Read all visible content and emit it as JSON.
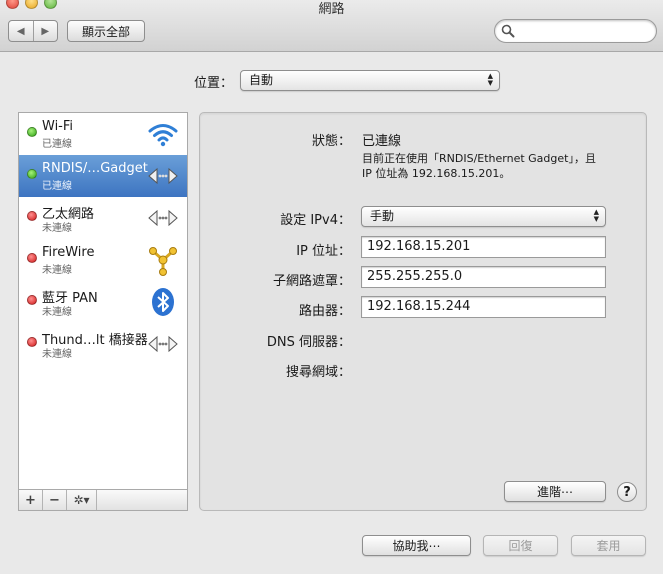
{
  "window": {
    "title": "網路"
  },
  "toolbar": {
    "back_label": "◀",
    "forward_label": "▶",
    "show_all_label": "顯示全部",
    "search_placeholder": "",
    "search_value": ""
  },
  "location": {
    "label": "位置：",
    "value": "自動"
  },
  "services": [
    {
      "name": "Wi-Fi",
      "status": "已連線",
      "status_color": "green",
      "icon": "wifi-icon",
      "selected": false
    },
    {
      "name": "RNDIS/…Gadget",
      "status": "已連線",
      "status_color": "green",
      "icon": "ethernet-arrows-icon",
      "selected": true
    },
    {
      "name": "乙太網路",
      "status": "未連線",
      "status_color": "red",
      "icon": "ethernet-arrows-icon",
      "selected": false
    },
    {
      "name": "FireWire",
      "status": "未連線",
      "status_color": "red",
      "icon": "firewire-icon",
      "selected": false
    },
    {
      "name": "藍牙 PAN",
      "status": "未連線",
      "status_color": "red",
      "icon": "bluetooth-icon",
      "selected": false
    },
    {
      "name": "Thund…lt 橋接器",
      "status": "未連線",
      "status_color": "red",
      "icon": "ethernet-arrows-icon",
      "selected": false
    }
  ],
  "sidebar_actions": {
    "add": "+",
    "remove": "−",
    "gear": "✲▾"
  },
  "detail": {
    "status_label": "狀態：",
    "status_value": "已連線",
    "status_desc_line1": "目前正在使用「RNDIS/Ethernet Gadget」，且",
    "status_desc_line2": "IP 位址為 192.168.15.201。",
    "configure_label": "設定 IPv4：",
    "configure_value": "手動",
    "ip_label": "IP 位址：",
    "ip_value": "192.168.15.201",
    "subnet_label": "子網路遮罩：",
    "subnet_value": "255.255.255.0",
    "router_label": "路由器：",
    "router_value": "192.168.15.244",
    "dns_label": "DNS 伺服器：",
    "search_domains_label": "搜尋網域：",
    "advanced_label": "進階⋯",
    "help_label": "?"
  },
  "footer": {
    "assist_label": "協助我⋯",
    "revert_label": "回復",
    "apply_label": "套用"
  },
  "colors": {
    "selection": "#3d74c1",
    "connected": "#2fa315",
    "disconnected": "#d11a1a"
  }
}
